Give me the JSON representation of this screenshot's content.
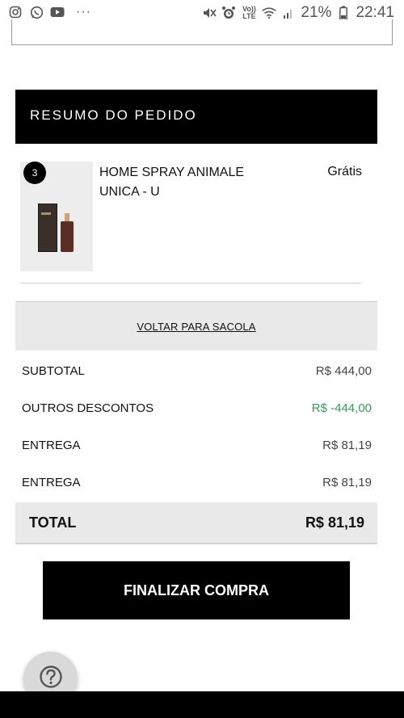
{
  "status_bar": {
    "battery": "21%",
    "time": "22:41",
    "network_badge_top": "Vo))",
    "network_badge_bottom": "LTE",
    "more_dots": "···",
    "left_icons": [
      "instagram-icon",
      "whatsapp-icon",
      "youtube-icon"
    ],
    "right_icons": [
      "mute-icon",
      "alarm-icon",
      "wifi-icon",
      "signal-icon",
      "battery-icon"
    ]
  },
  "summary": {
    "header": "RESUMO DO PEDIDO",
    "item": {
      "quantity": "3",
      "name": "HOME SPRAY ANIMALE UNICA - U",
      "price": "Grátis"
    },
    "back_link": "VOLTAR PARA SACOLA"
  },
  "totals": {
    "rows": [
      {
        "label": "SUBTOTAL",
        "value": "R$ 444,00"
      },
      {
        "label": "OUTROS DESCONTOS",
        "value": "R$ -444,00"
      },
      {
        "label": "ENTREGA",
        "value": "R$ 81,19"
      },
      {
        "label": "ENTREGA",
        "value": "R$ 81,19"
      }
    ],
    "total_label": "TOTAL",
    "total_value": "R$ 81,19"
  },
  "actions": {
    "finalize": "FINALIZAR COMPRA",
    "help_icon": "question-icon"
  },
  "colors": {
    "discount": "#3a9a5a",
    "primary": "#000000",
    "panel": "#e9e9e9"
  }
}
